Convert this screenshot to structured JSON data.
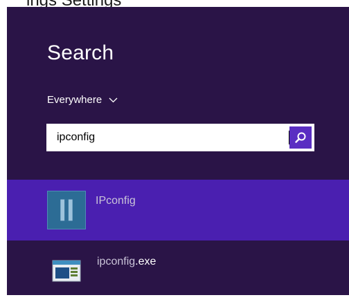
{
  "top_text": "ings  Settings",
  "search": {
    "title": "Search",
    "scope_label": "Everywhere",
    "query": "ipconfig"
  },
  "results": [
    {
      "name": "IPconfig",
      "icon": "ipconfig-app-icon",
      "selected": true
    },
    {
      "name_match": "ipconfig",
      "name_rest": ".exe",
      "icon": "exe-window-icon",
      "selected": false
    }
  ],
  "colors": {
    "pane": "#2a1447",
    "selected_row": "#4a1fb0",
    "search_button": "#5a2ec2"
  }
}
